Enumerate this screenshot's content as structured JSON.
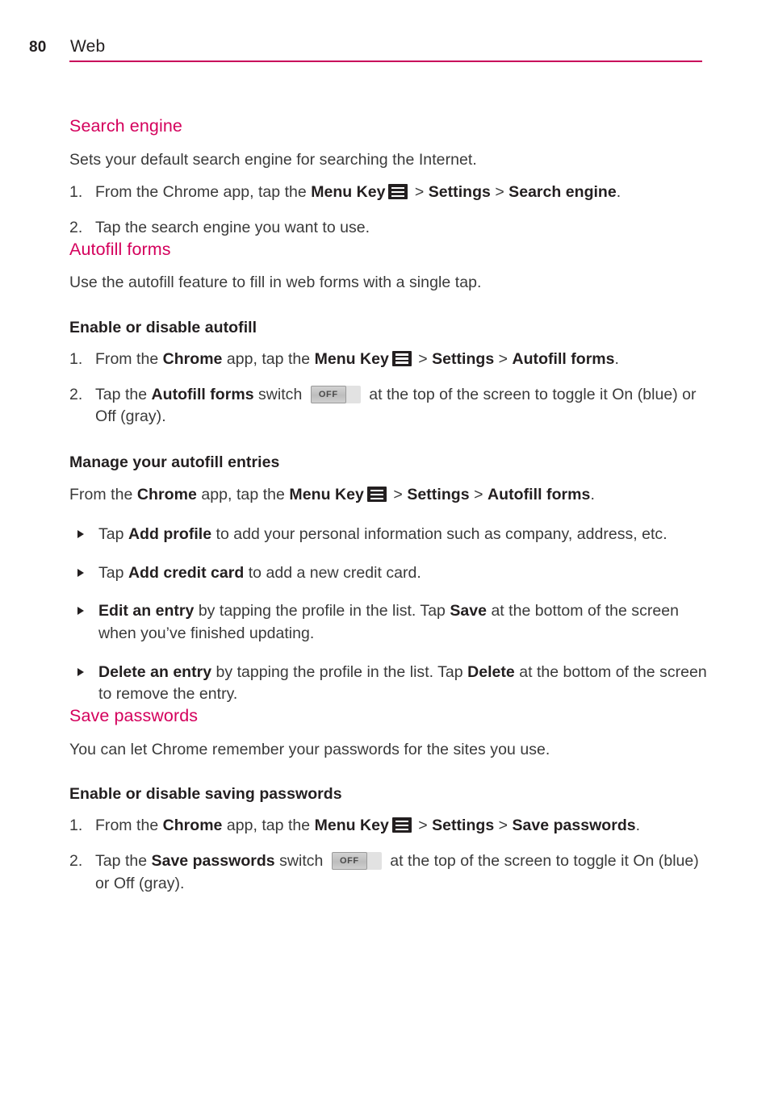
{
  "header": {
    "page_number": "80",
    "title": "Web",
    "rule_color": "#c8005a"
  },
  "theme": {
    "heading_color": "#d4005c",
    "body_color": "#3a3a3a",
    "bold_color": "#231f20"
  },
  "icons": {
    "menu_key": "menu-key-icon",
    "bullet": "triangle-bullet-icon",
    "switch": "toggle-switch-off-icon",
    "switch_label": "OFF"
  },
  "sections": {
    "search_engine": {
      "heading": "Search engine",
      "intro": "Sets your default search engine for searching the Internet.",
      "steps": [
        {
          "num": "1.",
          "parts": [
            {
              "t": "text",
              "v": "From the Chrome app, tap the "
            },
            {
              "t": "bold",
              "v": "Menu Key"
            },
            {
              "t": "icon",
              "v": "menu-key"
            },
            {
              "t": "text",
              "v": " > "
            },
            {
              "t": "bold",
              "v": "Settings"
            },
            {
              "t": "text",
              "v": " > "
            },
            {
              "t": "bold",
              "v": "Search engine"
            },
            {
              "t": "text",
              "v": "."
            }
          ]
        },
        {
          "num": "2.",
          "parts": [
            {
              "t": "text",
              "v": "Tap the search engine you want to use."
            }
          ]
        }
      ]
    },
    "autofill_forms": {
      "heading": "Autofill forms",
      "intro": "Use the autofill feature to fill in web forms with a single tap.",
      "sub_enable": {
        "heading": "Enable or disable autofill",
        "steps": [
          {
            "num": "1.",
            "parts": [
              {
                "t": "text",
                "v": "From the "
              },
              {
                "t": "bold",
                "v": "Chrome"
              },
              {
                "t": "text",
                "v": " app, tap the "
              },
              {
                "t": "bold",
                "v": "Menu Key"
              },
              {
                "t": "icon",
                "v": "menu-key"
              },
              {
                "t": "text",
                "v": " > "
              },
              {
                "t": "bold",
                "v": "Settings"
              },
              {
                "t": "text",
                "v": " > "
              },
              {
                "t": "bold",
                "v": "Autofill forms"
              },
              {
                "t": "text",
                "v": "."
              }
            ]
          },
          {
            "num": "2.",
            "parts": [
              {
                "t": "text",
                "v": "Tap the "
              },
              {
                "t": "bold",
                "v": "Autofill forms"
              },
              {
                "t": "text",
                "v": " switch "
              },
              {
                "t": "switch",
                "v": "OFF"
              },
              {
                "t": "text",
                "v": " at the top of the screen to toggle it On (blue) or Off (gray)."
              }
            ]
          }
        ]
      },
      "sub_manage": {
        "heading": "Manage your autofill entries",
        "lead": [
          {
            "t": "text",
            "v": "From the "
          },
          {
            "t": "bold",
            "v": "Chrome"
          },
          {
            "t": "text",
            "v": " app, tap the "
          },
          {
            "t": "bold",
            "v": "Menu Key"
          },
          {
            "t": "icon",
            "v": "menu-key"
          },
          {
            "t": "text",
            "v": " > "
          },
          {
            "t": "bold",
            "v": "Settings"
          },
          {
            "t": "text",
            "v": " > "
          },
          {
            "t": "bold",
            "v": "Autofill forms"
          },
          {
            "t": "text",
            "v": "."
          }
        ],
        "bullets": [
          [
            {
              "t": "text",
              "v": "Tap "
            },
            {
              "t": "bold",
              "v": "Add profile"
            },
            {
              "t": "text",
              "v": " to add your personal information such as company, address, etc."
            }
          ],
          [
            {
              "t": "text",
              "v": "Tap "
            },
            {
              "t": "bold",
              "v": "Add credit card"
            },
            {
              "t": "text",
              "v": " to add a new credit card."
            }
          ],
          [
            {
              "t": "bold",
              "v": "Edit an entry"
            },
            {
              "t": "text",
              "v": " by tapping the profile in the list. Tap "
            },
            {
              "t": "bold",
              "v": "Save"
            },
            {
              "t": "text",
              "v": " at the bottom of the screen when you’ve finished updating."
            }
          ],
          [
            {
              "t": "bold",
              "v": "Delete an entry"
            },
            {
              "t": "text",
              "v": " by tapping the profile in the list. Tap "
            },
            {
              "t": "bold",
              "v": "Delete"
            },
            {
              "t": "text",
              "v": " at the bottom of the screen to remove the entry."
            }
          ]
        ]
      }
    },
    "save_passwords": {
      "heading": "Save passwords",
      "intro": "You can let Chrome remember your passwords for the sites you use.",
      "sub_enable": {
        "heading": "Enable or disable saving passwords",
        "steps": [
          {
            "num": "1.",
            "parts": [
              {
                "t": "text",
                "v": "From the "
              },
              {
                "t": "bold",
                "v": "Chrome"
              },
              {
                "t": "text",
                "v": " app, tap the "
              },
              {
                "t": "bold",
                "v": "Menu Key"
              },
              {
                "t": "icon",
                "v": "menu-key"
              },
              {
                "t": "text",
                "v": " > "
              },
              {
                "t": "bold",
                "v": "Settings"
              },
              {
                "t": "text",
                "v": " > "
              },
              {
                "t": "bold",
                "v": "Save passwords"
              },
              {
                "t": "text",
                "v": "."
              }
            ]
          },
          {
            "num": "2.",
            "parts": [
              {
                "t": "text",
                "v": "Tap the "
              },
              {
                "t": "bold",
                "v": "Save passwords"
              },
              {
                "t": "text",
                "v": " switch "
              },
              {
                "t": "switch",
                "v": "OFF"
              },
              {
                "t": "text",
                "v": " at the top of the screen to toggle it On (blue) or Off (gray)."
              }
            ]
          }
        ]
      }
    }
  }
}
